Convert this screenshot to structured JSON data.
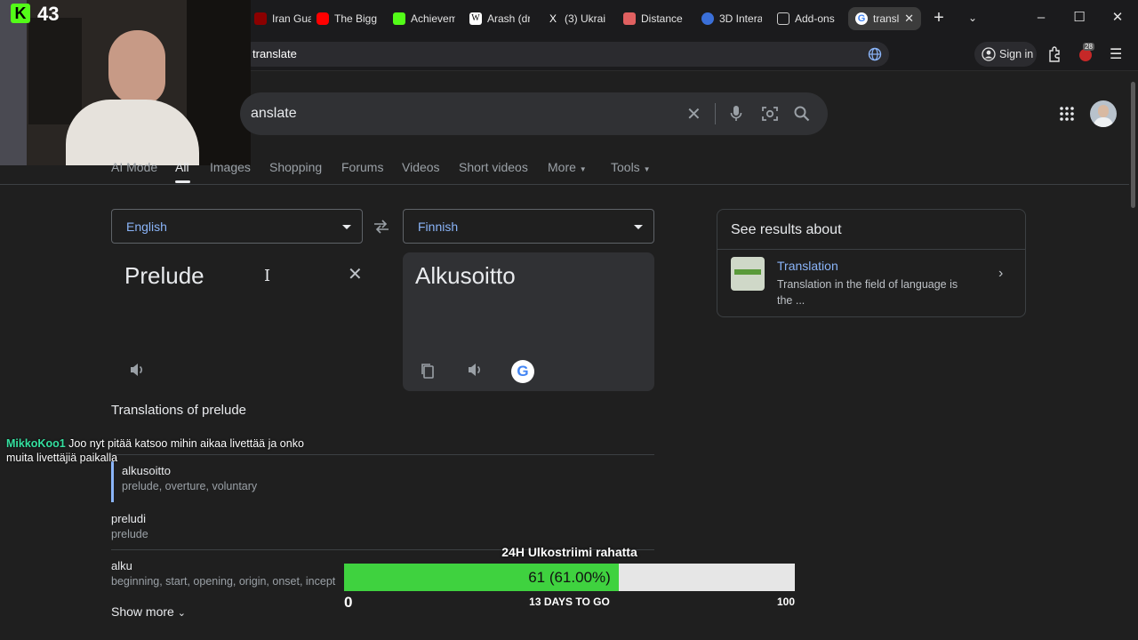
{
  "tabs": [
    {
      "label": "Iran Guar",
      "color": "#8b0000"
    },
    {
      "label": "The Bigg",
      "color": "#ff0000"
    },
    {
      "label": "Achievem",
      "color": "#53fc18"
    },
    {
      "label": "Arash (dr",
      "color": "#ffffff"
    },
    {
      "label": "(3) Ukrai",
      "color": "#000000"
    },
    {
      "label": "Distance",
      "color": "#e06060"
    },
    {
      "label": "3D Intera",
      "color": "#3a6fd8"
    },
    {
      "label": "Add-ons",
      "color": "#cccccc"
    },
    {
      "label": "transla",
      "color": "#4285f4"
    }
  ],
  "address": {
    "url": "translate",
    "sign_in": "Sign in",
    "ext_badge": "28"
  },
  "stream": {
    "kick_count": "43"
  },
  "search": {
    "query": "anslate"
  },
  "nav": {
    "ai_mode": "AI Mode",
    "all": "All",
    "images": "Images",
    "shopping": "Shopping",
    "forums": "Forums",
    "videos": "Videos",
    "short_videos": "Short videos",
    "more": "More",
    "tools": "Tools"
  },
  "translate": {
    "source_lang": "English",
    "target_lang": "Finnish",
    "source_text": "Prelude",
    "target_text": "Alkusoitto",
    "section_title": "Translations of prelude",
    "rows": [
      {
        "word": "alkusoitto",
        "synonyms": "prelude, overture, voluntary"
      },
      {
        "word": "preludi",
        "synonyms": "prelude"
      },
      {
        "word": "alku",
        "synonyms": "beginning, start, opening, origin, onset, incept"
      }
    ],
    "show_more": "Show more"
  },
  "side": {
    "header": "See results about",
    "title": "Translation",
    "desc_line1": "Translation in the field of language is",
    "desc_line2": "the ..."
  },
  "chat": {
    "user": "MikkoKoo1",
    "message_line1": "Joo nyt pitää katsoo mihin aikaa livettää ja onko",
    "message_line2": "muita livettäjiä paikalla"
  },
  "goal": {
    "title": "24H Ulkostriimi rahatta",
    "value_text": "61 (61.00%)",
    "progress": 0.61,
    "min": "0",
    "max": "100",
    "days": "13 DAYS TO GO"
  },
  "colors": {
    "accent_link": "#8ab4f8",
    "kick_green": "#53fc18",
    "progress_green": "#3fd23f"
  }
}
